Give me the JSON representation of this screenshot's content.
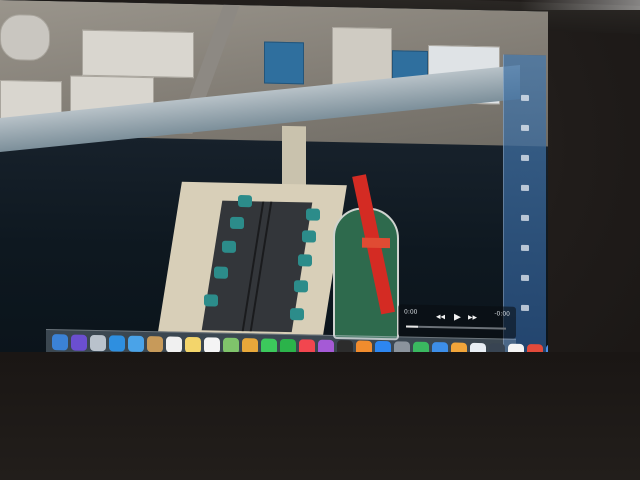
{
  "media_player": {
    "time_left": "0:00",
    "time_right": "-0:00",
    "progress": 0.12,
    "controls": [
      {
        "name": "rewind-icon",
        "glyph": "◂◂"
      },
      {
        "name": "play-icon",
        "glyph": "▶"
      },
      {
        "name": "forward-icon",
        "glyph": "▸▸"
      }
    ]
  },
  "dock": {
    "icons": [
      {
        "name": "finder-icon",
        "color": "#3b82d6"
      },
      {
        "name": "siri-icon",
        "color": "#6b4fd0"
      },
      {
        "name": "launchpad-icon",
        "color": "#b9c2cc"
      },
      {
        "name": "safari-icon",
        "color": "#2e8fe0"
      },
      {
        "name": "mail-icon",
        "color": "#4aa3e8"
      },
      {
        "name": "contacts-icon",
        "color": "#c79a5a"
      },
      {
        "name": "calendar-icon",
        "color": "#f0f0f0"
      },
      {
        "name": "notes-icon",
        "color": "#f3d56b"
      },
      {
        "name": "reminders-icon",
        "color": "#f4f4f4"
      },
      {
        "name": "maps-icon",
        "color": "#7fc36b"
      },
      {
        "name": "photos-icon",
        "color": "#e8a83a"
      },
      {
        "name": "messages-icon",
        "color": "#3cc95c"
      },
      {
        "name": "facetime-icon",
        "color": "#2bb34a"
      },
      {
        "name": "music-icon",
        "color": "#f2464f"
      },
      {
        "name": "podcasts-icon",
        "color": "#a55ad6"
      },
      {
        "name": "tv-icon",
        "color": "#2c2c2c"
      },
      {
        "name": "books-icon",
        "color": "#f18c2e"
      },
      {
        "name": "appstore-icon",
        "color": "#2d86f0"
      },
      {
        "name": "system-preferences-icon",
        "color": "#8a939c"
      },
      {
        "name": "numbers-icon",
        "color": "#3ab860"
      },
      {
        "name": "keynote-icon",
        "color": "#3d8ee8"
      },
      {
        "name": "pages-icon",
        "color": "#f1a53a"
      },
      {
        "name": "preview-icon",
        "color": "#e8eef4"
      },
      {
        "name": "quicktime-icon",
        "color": "#384452"
      },
      {
        "name": "textedit-icon",
        "color": "#f4f4f4"
      },
      {
        "name": "chrome-icon",
        "color": "#e24a3b"
      },
      {
        "name": "downloads-icon",
        "color": "#4b8fe6"
      },
      {
        "name": "trash-icon",
        "color": "#c8ced4"
      }
    ]
  },
  "side_panel": {
    "icons": [
      "panel-icon-1",
      "panel-icon-2",
      "panel-icon-3",
      "panel-icon-4",
      "panel-icon-5",
      "panel-icon-6",
      "panel-icon-7",
      "panel-icon-8"
    ]
  }
}
